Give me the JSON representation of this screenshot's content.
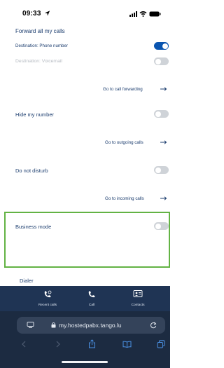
{
  "status": {
    "time": "09:33"
  },
  "forward": {
    "title": "Forward all my calls",
    "dest_phone": "Destination: Phone number",
    "dest_phone_on": true,
    "dest_voicemail": "Destination: Voicemail",
    "dest_voicemail_on": false,
    "link": "Go to call forwarding"
  },
  "hide_number": {
    "label": "Hide my number",
    "on": false,
    "link": "Go to outgoing calls"
  },
  "dnd": {
    "label": "Do not disturb",
    "on": false,
    "link": "Go to incoming calls"
  },
  "business": {
    "label": "Business mode",
    "on": false
  },
  "dialer": {
    "label": "Dialer"
  },
  "tabs": [
    {
      "label": "Recent calls",
      "icon": "recent-calls-icon"
    },
    {
      "label": "Call",
      "icon": "phone-icon"
    },
    {
      "label": "Contacts",
      "icon": "contacts-icon"
    }
  ],
  "browser": {
    "url": "my.hostedpabx.tango.lu"
  },
  "colors": {
    "accent": "#0a55b0",
    "text": "#1d3e6f",
    "highlight_border": "#63b344",
    "tabbar": "#1f3454"
  }
}
